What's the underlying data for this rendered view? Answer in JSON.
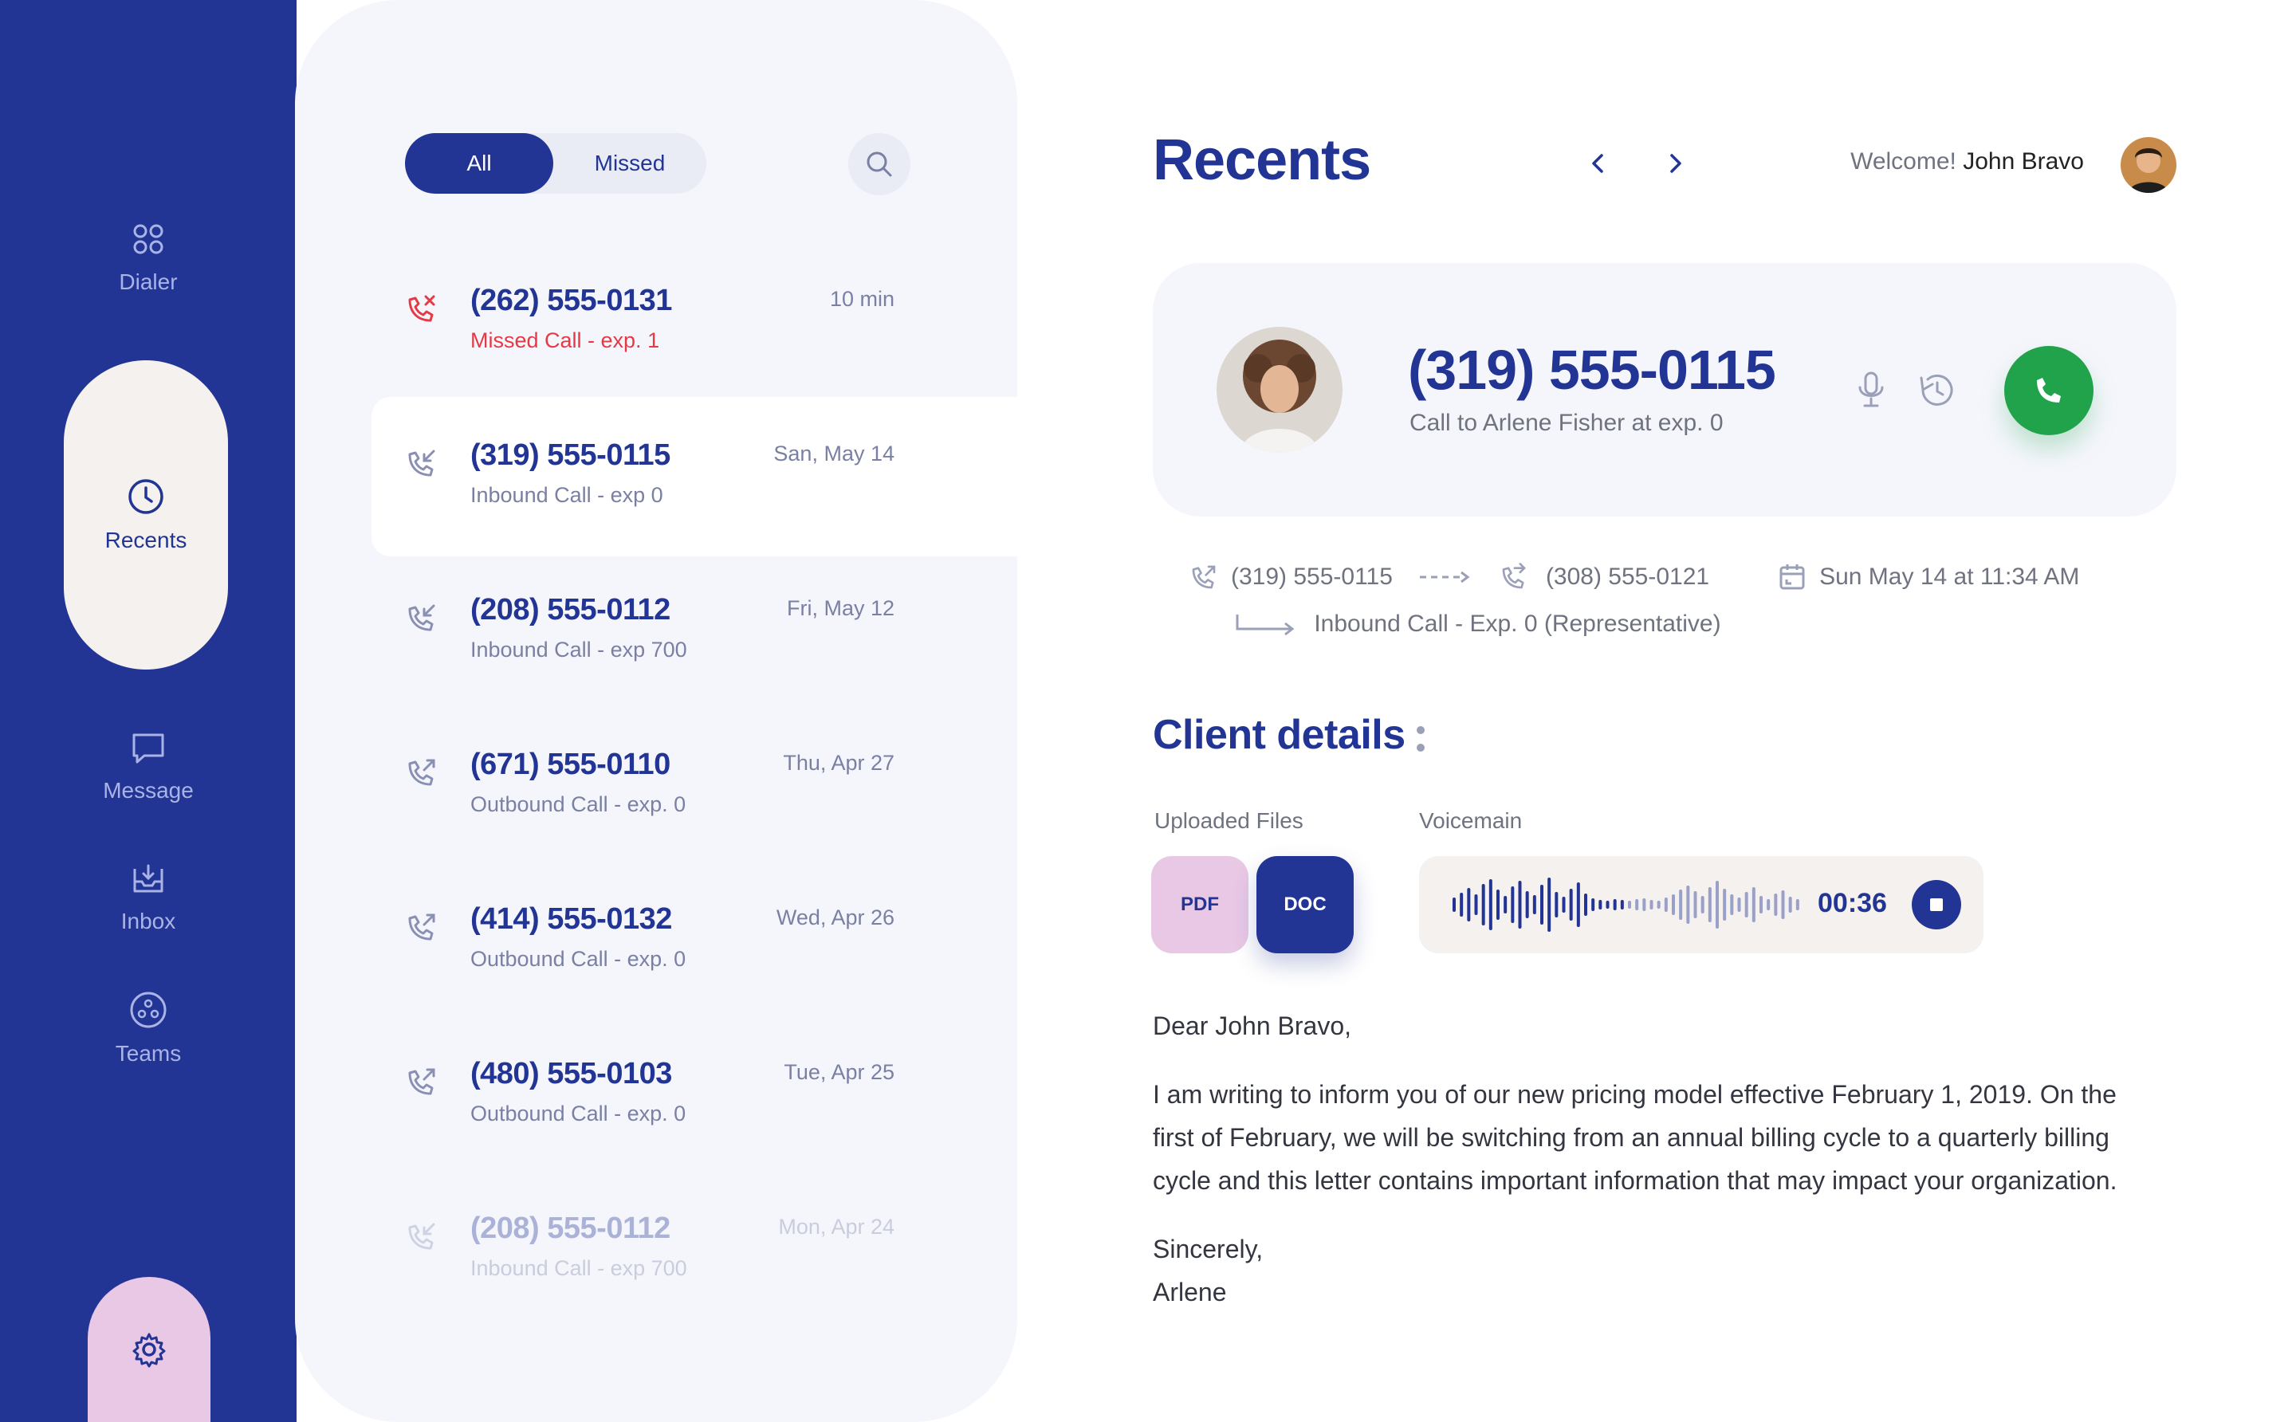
{
  "nav": {
    "items": [
      {
        "label": "Dialer",
        "icon": "dialer-icon"
      },
      {
        "label": "Recents",
        "icon": "clock-icon",
        "active": true
      },
      {
        "label": "Message",
        "icon": "message-icon"
      },
      {
        "label": "Inbox",
        "icon": "inbox-icon"
      },
      {
        "label": "Teams",
        "icon": "teams-icon"
      }
    ],
    "settings_icon": "gear-icon"
  },
  "filter": {
    "all": "All",
    "missed": "Missed",
    "search_icon": "search-icon"
  },
  "calls": [
    {
      "number": "(262) 555-0131",
      "detail": "Missed Call - exp. 1",
      "when": "10 min",
      "type": "missed"
    },
    {
      "number": "(319) 555-0115",
      "detail": "Inbound Call - exp 0",
      "when": "San, May 14",
      "type": "inbound",
      "selected": true
    },
    {
      "number": "(208) 555-0112",
      "detail": "Inbound Call - exp 700",
      "when": "Fri, May 12",
      "type": "inbound"
    },
    {
      "number": "(671) 555-0110",
      "detail": "Outbound Call - exp. 0",
      "when": "Thu, Apr 27",
      "type": "outbound"
    },
    {
      "number": "(414) 555-0132",
      "detail": "Outbound Call - exp. 0",
      "when": "Wed, Apr 26",
      "type": "outbound"
    },
    {
      "number": "(480) 555-0103",
      "detail": "Outbound Call - exp. 0",
      "when": "Tue, Apr 25",
      "type": "outbound"
    },
    {
      "number": "(208) 555-0112",
      "detail": "Inbound Call - exp 700",
      "when": "Mon, Apr 24",
      "type": "inbound",
      "faded": true
    }
  ],
  "header": {
    "title": "Recents",
    "welcome": "Welcome!",
    "user_name": "John Bravo"
  },
  "caller": {
    "number": "(319) 555-0115",
    "subtitle": "Call to Arlene Fisher at exp. 0"
  },
  "route": {
    "from": "(319) 555-0115",
    "to": "(308) 555-0121",
    "datetime": "Sun May 14 at 11:34 AM",
    "description": "Inbound Call - Exp. 0 (Representative)"
  },
  "client": {
    "title": "Client details",
    "files_label": "Uploaded Files",
    "files": [
      "PDF",
      "DOC"
    ],
    "voicemail_label": "Voicemain",
    "voicemail_duration": "00:36"
  },
  "letter": {
    "greeting": "Dear John Bravo,",
    "body_line1": "I am writing to inform you of our new pricing model effective February 1, 2019. On the",
    "body_line2": "first of February, we will be switching from an annual billing cycle to a quarterly billing",
    "body_line3": "cycle and this letter contains important information that may impact your organization.",
    "closing": "Sincerely,",
    "signature": "Arlene"
  },
  "colors": {
    "primary": "#233594",
    "accent_pink": "#e9c8e6",
    "cream": "#f4f1ee",
    "green": "#21a34c",
    "missed_red": "#e63946"
  }
}
